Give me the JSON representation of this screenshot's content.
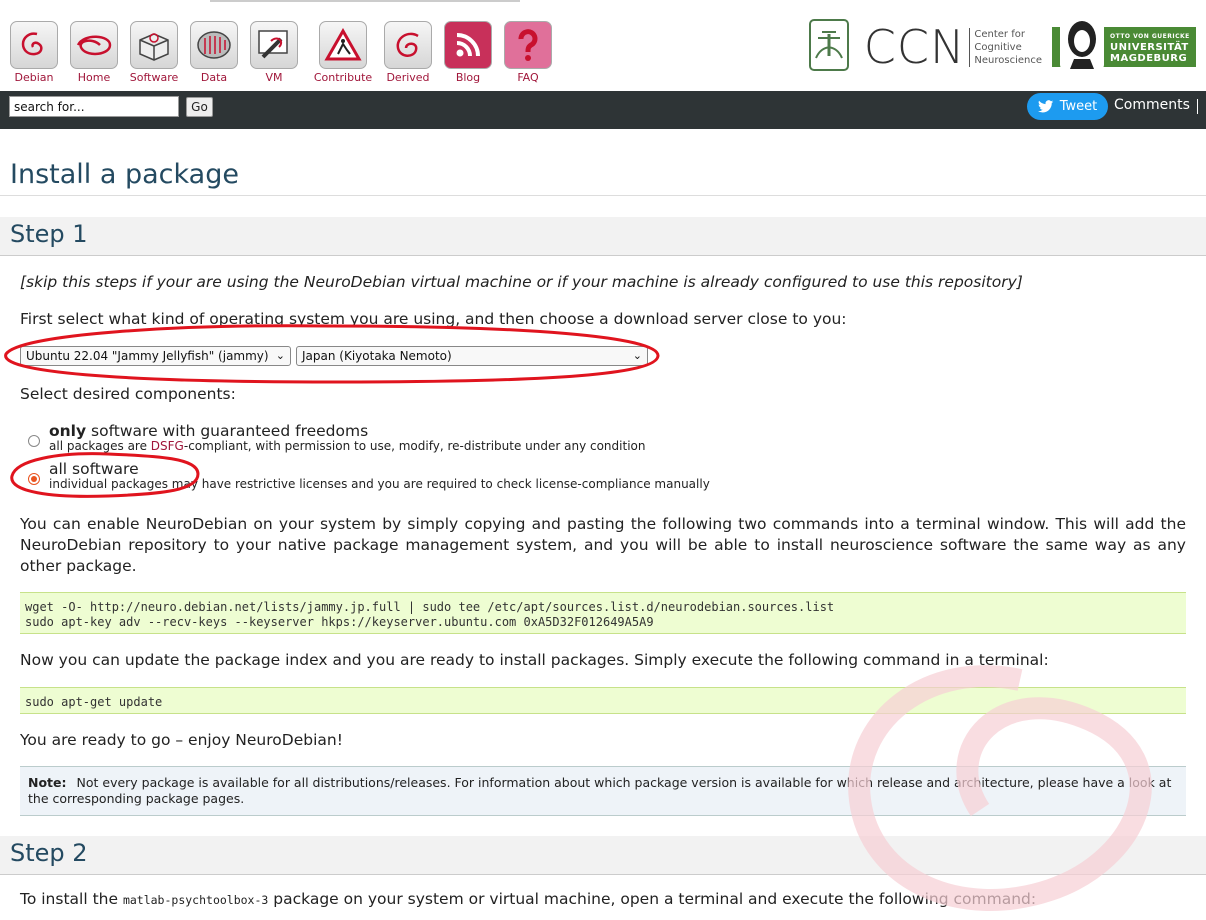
{
  "nav": [
    {
      "label": "Debian",
      "icon": "debian-swirl-icon"
    },
    {
      "label": "Home",
      "icon": "debian-swirl-icon"
    },
    {
      "label": "Software",
      "icon": "software-box-icon"
    },
    {
      "label": "Data",
      "icon": "data-brain-icon"
    },
    {
      "label": "VM",
      "icon": "vm-syringe-icon"
    },
    {
      "label": "Contribute",
      "icon": "contribute-warning-icon"
    },
    {
      "label": "Derived",
      "icon": "debian-swirl-icon"
    },
    {
      "label": "Blog",
      "icon": "rss-feed-icon"
    },
    {
      "label": "FAQ",
      "icon": "question-mark-icon"
    }
  ],
  "logos": {
    "ccn": "CCN",
    "ccn_sub": [
      "Center for",
      "Cognitive",
      "Neuroscience"
    ],
    "ovgu_small": "OTTO VON GUERICKE",
    "ovgu_line1": "UNIVERSITÄT",
    "ovgu_line2": "MAGDEBURG"
  },
  "search": {
    "placeholder": "search for...",
    "go_label": "Go"
  },
  "social": {
    "tweet_label": "Tweet",
    "comments_label": "Comments"
  },
  "page": {
    "title": "Install a package",
    "step1_title": "Step 1",
    "skip_note": "[skip this steps if your are using the NeuroDebian virtual machine or if your machine is already configured to use this repository]",
    "select_intro": "First select what kind of operating system you are using, and then choose a download server close to you:",
    "os_select": "Ubuntu 22.04 \"Jammy Jellyfish\" (jammy)",
    "server_select": "Japan (Kiyotaka Nemoto)",
    "components_label": "Select desired components:",
    "opt1_bold": "only",
    "opt1_rest": " software with guaranteed freedoms",
    "opt1_desc_a": "all packages are ",
    "opt1_desc_link": "DSFG",
    "opt1_desc_b": "-compliant, with permission to use, modify, re-distribute under any condition",
    "opt2_title": "all software",
    "opt2_desc": "individual packages may have restrictive licenses and you are required to check license-compliance manually",
    "enable_text": "You can enable NeuroDebian on your system by simply copying and pasting the following two commands into a terminal window. This will add the NeuroDebian repository to your native package management system, and you will be able to install neuroscience software the same way as any other package.",
    "cmd1_line1": "wget -O- http://neuro.debian.net/lists/jammy.jp.full | sudo tee /etc/apt/sources.list.d/neurodebian.sources.list",
    "cmd1_line2": "sudo apt-key adv --recv-keys --keyserver hkps://keyserver.ubuntu.com 0xA5D32F012649A5A9",
    "update_text": "Now you can update the package index and you are ready to install packages. Simply execute the following command in a terminal:",
    "cmd2": "sudo apt-get update",
    "ready_text": "You are ready to go – enjoy NeuroDebian!",
    "note_label": "Note:",
    "note_text": "Not every package is available for all distributions/releases. For information about which package version is available for which release and architecture, please have a look at the corresponding package pages.",
    "step2_title": "Step 2",
    "install_a": "To install the ",
    "install_pkg": "matlab-psychtoolbox-3",
    "install_b": " package on your system or virtual machine, open a terminal and execute the following command:"
  },
  "colors": {
    "accent": "#a0163a",
    "heading": "#244a61",
    "annotation": "#e0141e"
  }
}
